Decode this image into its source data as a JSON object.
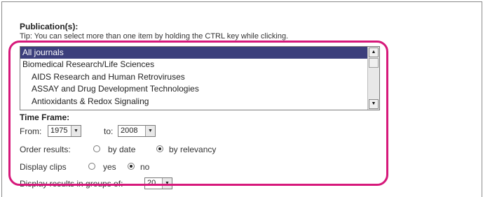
{
  "form": {
    "publications_label": "Publication(s):",
    "tip": "Tip: You can select more than one item by holding the CTRL key while clicking.",
    "journals": [
      {
        "label": "All journals",
        "selected": true
      },
      {
        "label": "Biomedical Research/Life Sciences",
        "selected": false
      },
      {
        "label": "AIDS Research and Human Retroviruses",
        "selected": false
      },
      {
        "label": "ASSAY and Drug Development Technologies",
        "selected": false
      },
      {
        "label": "Antioxidants & Redox Signaling",
        "selected": false
      }
    ],
    "time_frame_label": "Time Frame:",
    "from_label": "From:",
    "from_value": "1975",
    "to_label": "to:",
    "to_value": "2008",
    "order_label": "Order results:",
    "order_options": [
      "by date",
      "by relevancy"
    ],
    "order_selected": "by relevancy",
    "clips_label": "Display clips",
    "clips_options": [
      "yes",
      "no"
    ],
    "clips_selected": "no",
    "groups_label": "Display results in groups of:",
    "groups_value": "20"
  },
  "colors": {
    "selection_bg": "#3c3f7c",
    "highlight": "#d6187a"
  }
}
